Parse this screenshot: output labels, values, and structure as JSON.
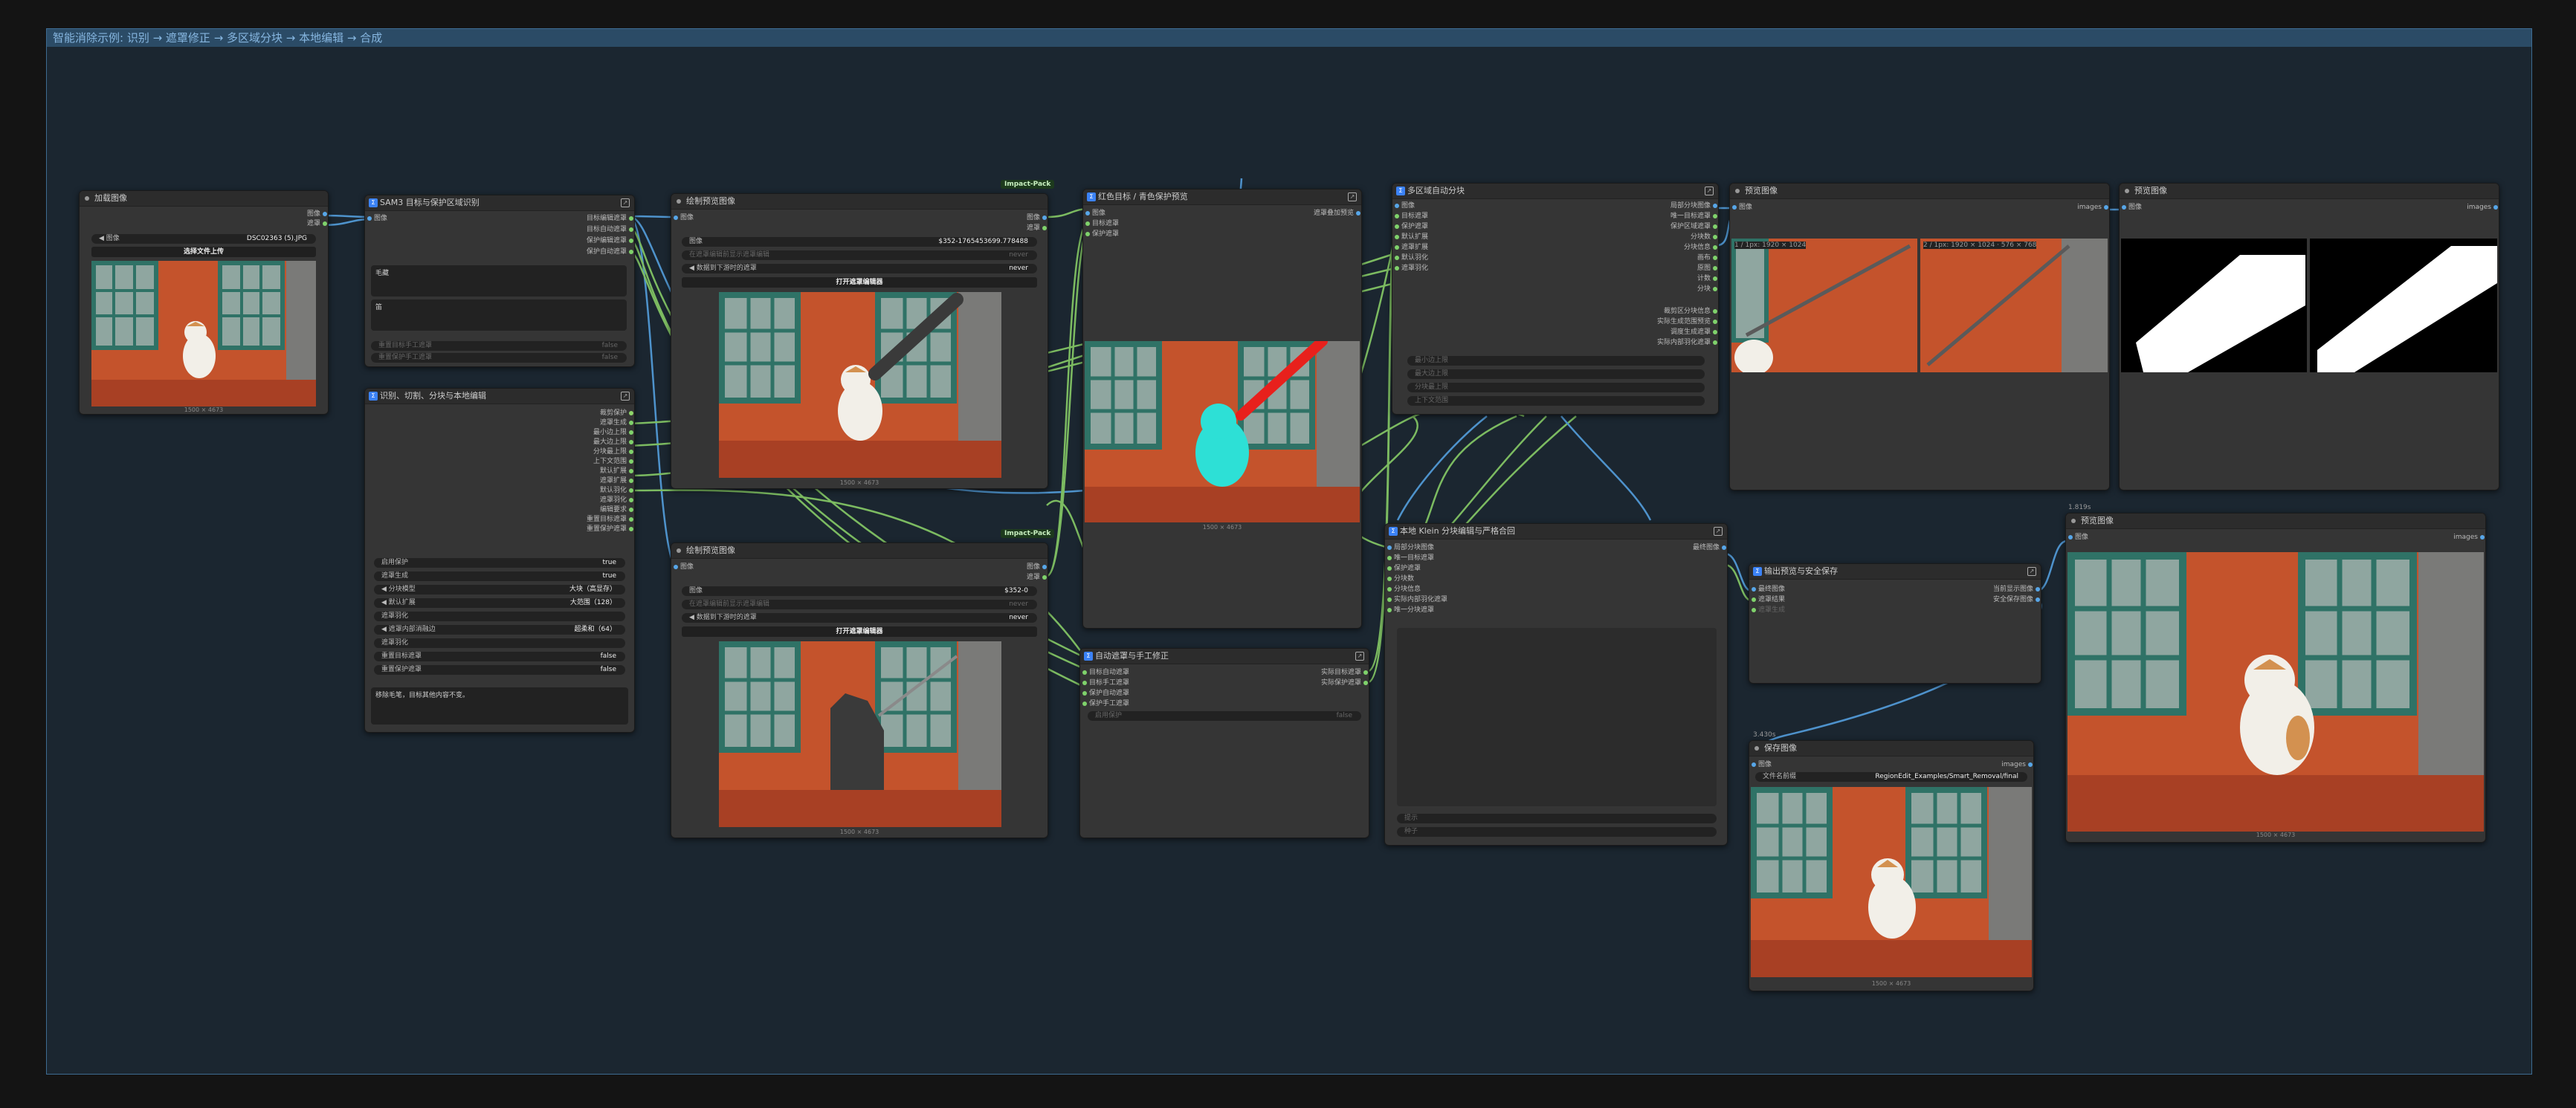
{
  "group": {
    "title": "智能消除示例: 识别 → 遮罩修正 → 多区域分块 → 本地编辑 → 合成"
  },
  "load": {
    "title": "加载图像",
    "out_image": "图像",
    "out_mask": "遮罩",
    "in_image": "图像",
    "filename": "DSC02363 (5).JPG",
    "upload": "选择文件上传",
    "caption": "1500 × 4673"
  },
  "sam": {
    "title": "SAM3 目标与保护区域识别",
    "in_image": "图像",
    "outs": [
      "目标编辑遮罩",
      "目标自动遮罩",
      "保护编辑遮罩",
      "保护自动遮罩"
    ],
    "text1_label": "毛藏",
    "text2_label": "笛",
    "w1": "重置目标手工遮罩",
    "w1v": "false",
    "w2": "重置保护手工遮罩",
    "w2v": "false"
  },
  "plan": {
    "title": "识别、切割、分块与本地编辑",
    "outs": [
      "裁剪保护",
      "遮罩生成",
      "最小边上限",
      "最大边上限",
      "分块最上限",
      "上下文范围",
      "默认扩展",
      "遮罩扩展",
      "默认羽化",
      "遮罩羽化",
      "编辑要求",
      "重置目标遮罩",
      "重置保护遮罩"
    ],
    "widgets": [
      {
        "label": "启用保护",
        "value": "true"
      },
      {
        "label": "遮罩生成",
        "value": "true"
      },
      {
        "label": "分块模型",
        "value": "大块（高显存）"
      },
      {
        "label": "默认扩展",
        "value": "大范围（128）"
      },
      {
        "label": "遮罩羽化",
        "value": ""
      },
      {
        "label": "遮罩内部消融边",
        "value": "超柔和（64）"
      },
      {
        "label": "遮罩羽化",
        "value": ""
      },
      {
        "label": "重置目标遮罩",
        "value": "false"
      },
      {
        "label": "重置保护遮罩",
        "value": "false"
      }
    ],
    "prompt": "移除毛笔，目标其他内容不变。"
  },
  "mask1": {
    "title": "绘制预览图像",
    "tag": "Impact-Pack",
    "in_image": "图像",
    "out_image": "图像",
    "out_mask": "遮罩",
    "w_image": "图像",
    "w_image_v": "$352-1765453699.778488",
    "w2": "在遮罩编辑前显示遮罩编辑",
    "w2v": "never",
    "w3": "数据到下游时的遮罩",
    "w3v": "never",
    "btn": "打开遮罩编辑器",
    "caption": "1500 × 4673"
  },
  "mask2": {
    "title": "绘制预览图像",
    "tag": "Impact-Pack",
    "in_image": "图像",
    "out_image": "图像",
    "out_mask": "遮罩",
    "w_image": "图像",
    "w_image_v": "$352-0",
    "w2": "在遮罩编辑前显示遮罩编辑",
    "w2v": "never",
    "w3": "数据到下游时的遮罩",
    "w3v": "never",
    "btn": "打开遮罩编辑器",
    "caption": "1500 × 4673"
  },
  "color": {
    "title": "红色目标 / 青色保护预览",
    "ins": [
      "图像",
      "目标遮罩",
      "保护遮罩"
    ],
    "out": "遮罩叠加预览",
    "caption": "1500 × 4673"
  },
  "fix": {
    "title": "自动遮罩与手工修正",
    "ins": [
      "目标自动遮罩",
      "目标手工遮罩",
      "保护自动遮罩",
      "保护手工遮罩"
    ],
    "outs": [
      "实际目标遮罩",
      "实际保护遮罩"
    ],
    "w": "启用保护",
    "wv": "false"
  },
  "split": {
    "title": "多区域自动分块",
    "ins": [
      "图像",
      "目标遮罩",
      "保护遮罩",
      "默认扩展",
      "遮罩扩展",
      "默认羽化",
      "遮罩羽化"
    ],
    "outs": [
      "局部分块图像",
      "唯一目标遮罩",
      "保护区域遮罩",
      "分块数",
      "分块信息",
      "画布",
      "原图",
      "计数",
      "分块",
      "裁剪区分块信息",
      "实际生成范围预览",
      "调度生成遮罩",
      "实际内部羽化遮罩"
    ],
    "dim": [
      "最小边上限",
      "最大边上限",
      "分块最上限",
      "上下文范围"
    ]
  },
  "klein": {
    "title": "本地 Klein 分块编辑与严格合回",
    "ins": [
      "局部分块图像",
      "唯一目标遮罩",
      "保护遮罩",
      "分块数",
      "分块信息",
      "实际内部羽化遮罩",
      "唯一分块遮罩"
    ],
    "out": "最终图像",
    "dim": [
      "提示",
      "种子"
    ]
  },
  "prev1": {
    "title": "预览图像",
    "in": "图像",
    "out": "images",
    "labels": [
      "1 / 1px: 1920 × 1024",
      "2 / 1px: 1920 × 1024 · 576 × 768"
    ]
  },
  "prev2": {
    "title": "预览图像",
    "in": "图像",
    "out": "images"
  },
  "out": {
    "title": "输出预览与安全保存",
    "ins": [
      "最终图像",
      "遮罩结果"
    ],
    "dim": "遮罩生成",
    "outs": [
      "当前显示图像",
      "安全保存图像"
    ]
  },
  "prev3": {
    "title": "预览图像",
    "in": "图像",
    "out": "images",
    "caption": "1500 × 4673",
    "time": "1.819s"
  },
  "save": {
    "title": "保存图像",
    "in": "图像",
    "out": "images",
    "w": "文件名前缀",
    "wv": "RegionEdit_Examples/Smart_Removal/final",
    "caption": "1500 × 4673",
    "time": "3.430s"
  },
  "colors": {
    "bg": "#1b2630",
    "node": "#353535",
    "link_green": "#8ed66a",
    "link_blue": "#57a6e8",
    "brick": "#c4532c",
    "cyan": "#2de0d6"
  }
}
